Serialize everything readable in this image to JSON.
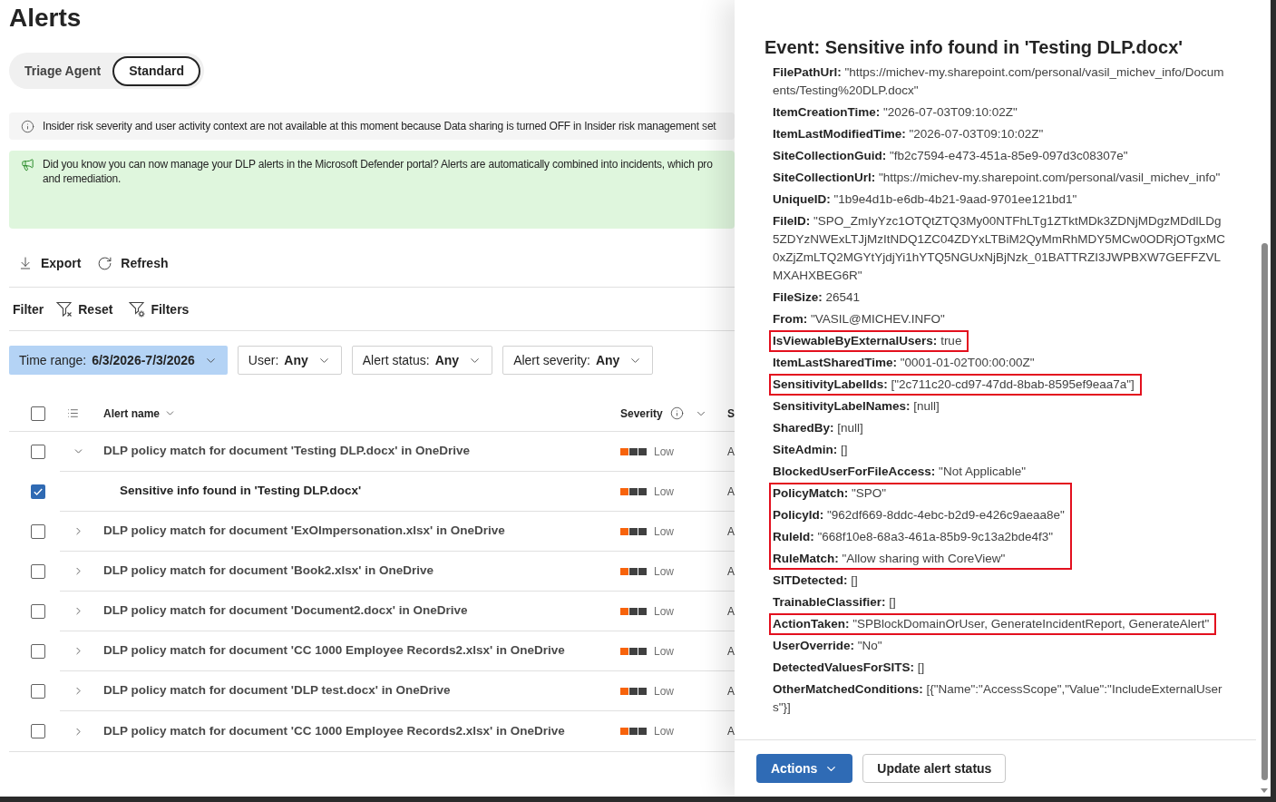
{
  "page": {
    "title": "Alerts"
  },
  "tabs": [
    {
      "label": "Triage Agent",
      "selected": false
    },
    {
      "label": "Standard",
      "selected": true
    }
  ],
  "info_bar": {
    "text": "Insider risk severity and user activity context are not available at this moment because Data sharing is turned OFF in Insider risk management set"
  },
  "banner": {
    "lines": [
      "Did you know you can now manage your DLP alerts in the Microsoft Defender portal? Alerts are automatically combined into incidents, which pro",
      "and remediation."
    ]
  },
  "toolbar": {
    "actions": [
      "Export",
      "Refresh"
    ]
  },
  "filter_bar": {
    "label": "Filter",
    "actions": [
      "Reset",
      "Filters"
    ]
  },
  "filters": [
    {
      "label": "Time range:",
      "value": "6/3/2026-7/3/2026",
      "selected": true
    },
    {
      "label": "User:",
      "value": "Any",
      "selected": false
    },
    {
      "label": "Alert status:",
      "value": "Any",
      "selected": false
    },
    {
      "label": "Alert severity:",
      "value": "Any",
      "selected": false
    }
  ],
  "table": {
    "select_all": {
      "checked": false
    },
    "columns": [
      {
        "label": "Alert name"
      },
      {
        "label": "Severity"
      },
      {
        "label": "S"
      }
    ],
    "rows": [
      {
        "alert_name": "DLP policy match for document 'Testing DLP.docx' in OneDrive",
        "checked": false,
        "expanded": true,
        "severity": "Low",
        "level": 0.33,
        "column_3": "A",
        "children": [
          {
            "alert_name": "Sensitive info found in 'Testing DLP.docx'",
            "checked": true,
            "severity": "Low",
            "level": 0.33,
            "column_3": "A"
          }
        ]
      },
      {
        "alert_name": "DLP policy match for document 'ExOImpersonation.xlsx' in OneDrive",
        "checked": false,
        "expanded": false,
        "severity": "Low",
        "level": 0.33,
        "column_3": "A"
      },
      {
        "alert_name": "DLP policy match for document 'Book2.xlsx' in OneDrive",
        "checked": false,
        "expanded": false,
        "severity": "Low",
        "level": 0.33,
        "column_3": "A"
      },
      {
        "alert_name": "DLP policy match for document 'Document2.docx' in OneDrive",
        "checked": false,
        "expanded": false,
        "severity": "Low",
        "level": 0.33,
        "column_3": "A"
      },
      {
        "alert_name": "DLP policy match for document 'CC 1000 Employee Records2.xlsx' in OneDrive",
        "checked": false,
        "expanded": false,
        "severity": "Low",
        "level": 0.33,
        "column_3": "A"
      },
      {
        "alert_name": "DLP policy match for document 'DLP test.docx' in OneDrive",
        "checked": false,
        "expanded": false,
        "severity": "Low",
        "level": 0.33,
        "column_3": "A"
      },
      {
        "alert_name": "DLP policy match for document 'CC 1000 Employee Records2.xlsx' in OneDrive",
        "checked": false,
        "expanded": false,
        "severity": "Low",
        "level": 0.33,
        "column_3": "A"
      }
    ]
  },
  "panel": {
    "title": "Event: Sensitive info found in 'Testing DLP.docx'",
    "sections": [
      {
        "highlighted": false,
        "fields": [
          {
            "label": "FilePathUrl:",
            "value": "\"https://michev-my.sharepoint.com/personal/vasil_michev_info/Documents/Testing%20DLP.docx\""
          },
          {
            "label": "ItemCreationTime:",
            "value": "\"2026-07-03T09:10:02Z\""
          },
          {
            "label": "ItemLastModifiedTime:",
            "value": "\"2026-07-03T09:10:02Z\""
          },
          {
            "label": "SiteCollectionGuid:",
            "value": "\"fb2c7594-e473-451a-85e9-097d3c08307e\""
          },
          {
            "label": "SiteCollectionUrl:",
            "value": "\"https://michev-my.sharepoint.com/personal/vasil_michev_info\""
          },
          {
            "label": "UniqueID:",
            "value": "\"1b9e4d1b-e6db-4b21-9aad-9701ee121bd1\""
          },
          {
            "label": "FileID:",
            "value": "\"SPO_ZmIyYzc1OTQtZTQ3My00NTFhLTg1ZTktMDk3ZDNjMDgzMDdlLDg5ZDYzNWExLTJjMzItNDQ1ZC04ZDYxLTBiM2QyMmRhMDY5MCw0ODRjOTgxMC0xZjZmLTQ2MGYtYjdjYi1hYTQ5NGUxNjBjNzk_01BATTRZI3JWPBXW7GEFFZVLMXAHXBEG6R\""
          },
          {
            "label": "FileSize:",
            "value": "26541"
          },
          {
            "label": "From:",
            "value": "\"VASIL@MICHEV.INFO\""
          }
        ]
      },
      {
        "highlighted": true,
        "fields": [
          {
            "label": "IsViewableByExternalUsers:",
            "value": "true"
          }
        ]
      },
      {
        "highlighted": false,
        "fields": [
          {
            "label": "ItemLastSharedTime:",
            "value": "\"0001-01-02T00:00:00Z\""
          }
        ]
      },
      {
        "highlighted": true,
        "fields": [
          {
            "label": "SensitivityLabelIds:",
            "value": "[\"2c711c20-cd97-47dd-8bab-8595ef9eaa7a\"]"
          }
        ]
      },
      {
        "highlighted": false,
        "fields": [
          {
            "label": "SensitivityLabelNames:",
            "value": "[null]"
          },
          {
            "label": "SharedBy:",
            "value": "[null]"
          },
          {
            "label": "SiteAdmin:",
            "value": "[]"
          },
          {
            "label": "BlockedUserForFileAccess:",
            "value": "\"Not Applicable\""
          }
        ]
      },
      {
        "highlighted": true,
        "fields": [
          {
            "label": "PolicyMatch:",
            "value": "\"SPO\""
          },
          {
            "label": "PolicyId:",
            "value": "\"962df669-8ddc-4ebc-b2d9-e426c9aeaa8e\""
          },
          {
            "label": "RuleId:",
            "value": "\"668f10e8-68a3-461a-85b9-9c13a2bde4f3\""
          },
          {
            "label": "RuleMatch:",
            "value": "\"Allow sharing with CoreView\""
          }
        ]
      },
      {
        "highlighted": false,
        "fields": [
          {
            "label": "SITDetected:",
            "value": "[]"
          },
          {
            "label": "TrainableClassifier:",
            "value": "[]"
          }
        ]
      },
      {
        "highlighted": true,
        "fields": [
          {
            "label": "ActionTaken:",
            "value": "\"SPBlockDomainOrUser, GenerateIncidentReport, GenerateAlert\""
          }
        ]
      },
      {
        "highlighted": false,
        "fields": [
          {
            "label": "UserOverride:",
            "value": "\"No\""
          },
          {
            "label": "DetectedValuesForSITS:",
            "value": "[]"
          },
          {
            "label": "OtherMatchedConditions:",
            "value": "[{\"Name\":\"AccessScope\",\"Value\":\"IncludeExternalUsers\"}]"
          }
        ]
      }
    ],
    "buttons": [
      {
        "label": "Actions",
        "kind": "primary"
      },
      {
        "label": "Update alert status",
        "kind": "secondary"
      }
    ]
  }
}
